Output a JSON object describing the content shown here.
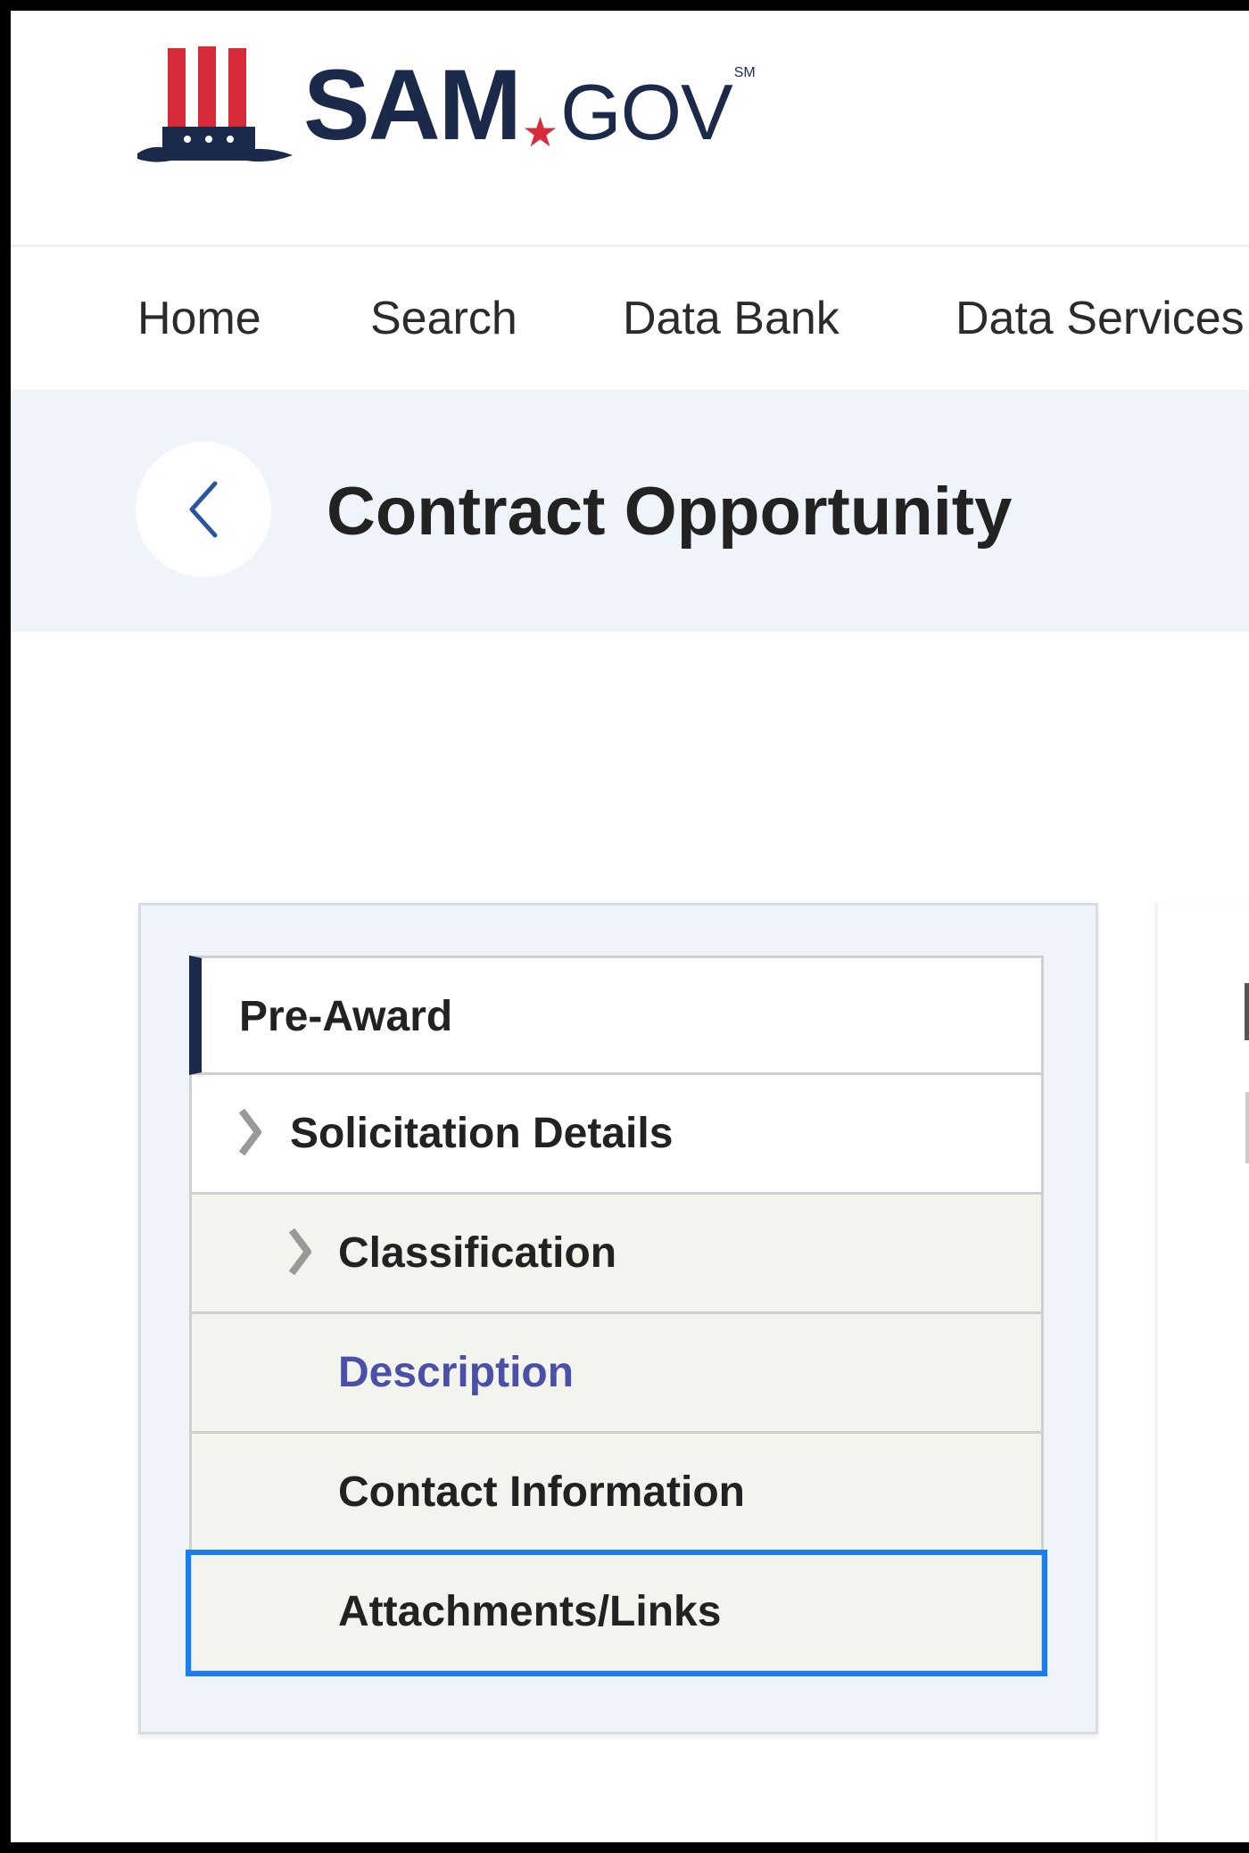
{
  "brand": {
    "sam": "SAM",
    "gov": "GOV",
    "service_mark": "SM"
  },
  "nav": [
    "Home",
    "Search",
    "Data Bank",
    "Data Services"
  ],
  "page_title": "Contract Opportunity",
  "side_nav": {
    "header": "Pre-Award",
    "items": [
      "Solicitation Details",
      "Classification",
      "Description",
      "Contact Information",
      "Attachments/Links"
    ]
  },
  "colors": {
    "brand_navy": "#1b2a4a",
    "brand_red": "#d72b3a",
    "link": "#4a50a8",
    "focus": "#1a7ef0",
    "band": "#eef4fa"
  },
  "icons": {
    "logo": "uncle-sam-hat-icon",
    "back": "chevron-left-icon",
    "expand": "chevron-right-icon"
  }
}
